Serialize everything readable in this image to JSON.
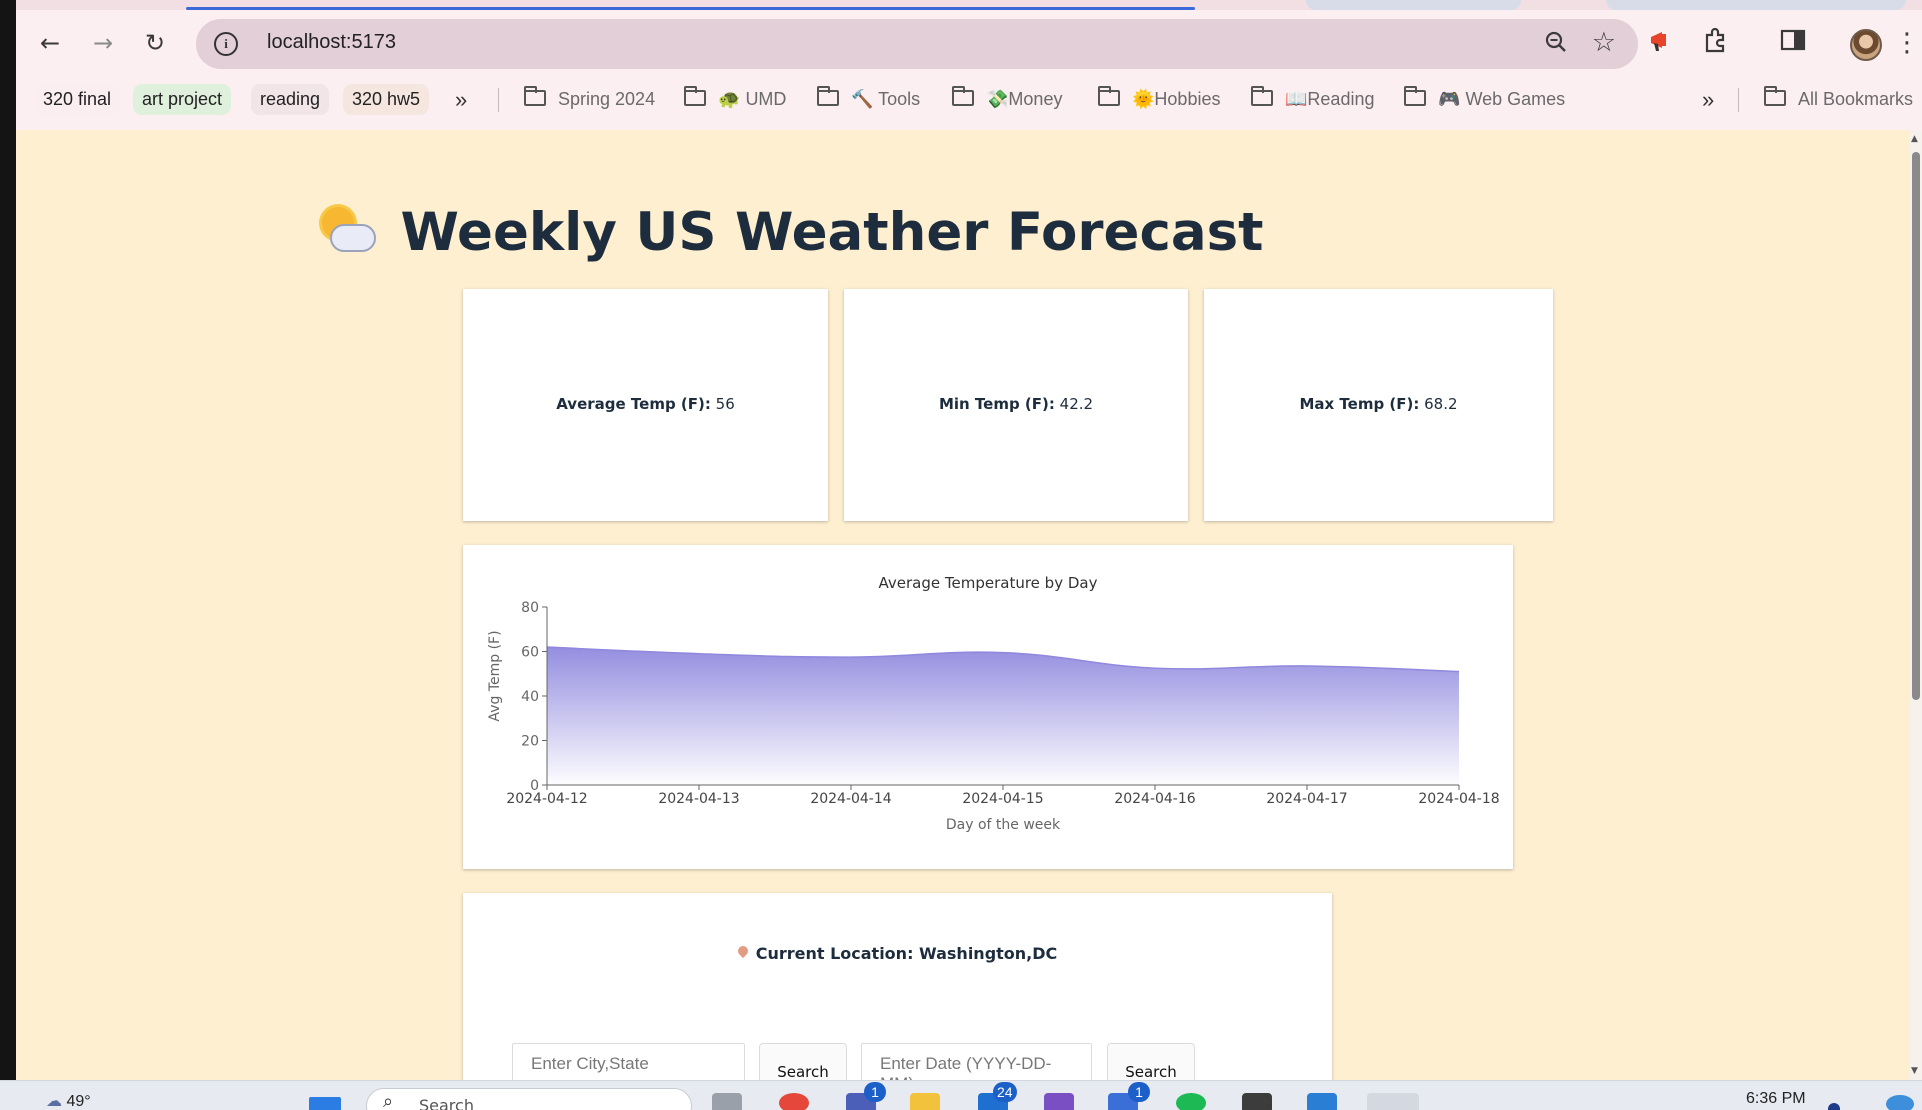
{
  "browser": {
    "url": "localhost:5173",
    "bookmark_chips": [
      "320 final",
      "art project",
      "reading",
      "320 hw5"
    ],
    "bookmark_folders": [
      "Spring 2024",
      "UMD",
      "Tools",
      "Money",
      "Hobbies",
      "Reading",
      "Web Games"
    ],
    "bookmark_emoji": [
      "",
      "🐢",
      "🔨",
      "💸",
      "🌞",
      "📖",
      "🎮"
    ],
    "overflow_glyph": "»",
    "all_bookmarks": "All Bookmarks"
  },
  "page": {
    "title": "Weekly US Weather Forecast",
    "stats": [
      {
        "label": "Average Temp (F):",
        "value": "56"
      },
      {
        "label": "Min Temp (F):",
        "value": "42.2"
      },
      {
        "label": "Max Temp (F):",
        "value": "68.2"
      }
    ],
    "location_label": "Current Location: Washington,DC",
    "city_placeholder": "Enter City,State",
    "date_placeholder": "Enter Date (YYYY-DD-MM)",
    "search_label": "Search"
  },
  "chart_data": {
    "type": "area",
    "title": "Average Temperature by Day",
    "xlabel": "Day of the week",
    "ylabel": "Avg Temp (F)",
    "x": [
      "2024-04-12",
      "2024-04-13",
      "2024-04-14",
      "2024-04-15",
      "2024-04-16",
      "2024-04-17",
      "2024-04-18"
    ],
    "series": [
      {
        "values": [
          62,
          59,
          57.5,
          59.5,
          52.5,
          53.5,
          51
        ]
      }
    ],
    "ylim": [
      0,
      80
    ],
    "yticks": [
      0,
      20,
      40,
      60,
      80
    ],
    "fill_color": "#8f88de"
  },
  "taskbar": {
    "weather": "49°",
    "search_placeholder": "Search",
    "time": "6:36 PM",
    "badges": [
      "1",
      "24",
      "1"
    ]
  }
}
